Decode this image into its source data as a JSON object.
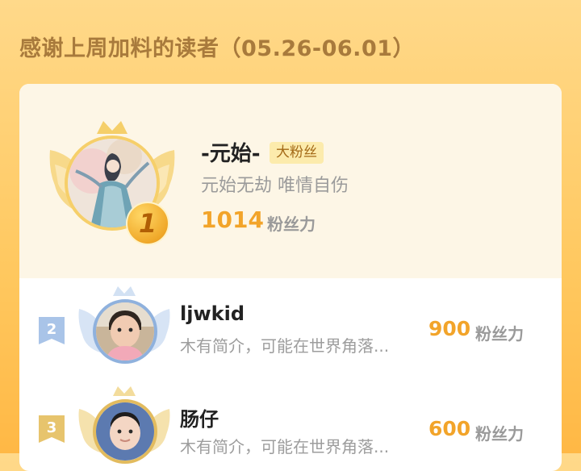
{
  "header": {
    "title": "感谢上周加料的读者（05.26-06.01）"
  },
  "top_reader": {
    "rank": "1",
    "name": "-元始-",
    "tag": "大粉丝",
    "bio": "元始无劫 唯情自伤",
    "score": "1014",
    "score_unit": "粉丝力"
  },
  "readers": [
    {
      "rank": "2",
      "name": "ljwkid",
      "bio": "木有简介，可能在世界角落...",
      "score": "900",
      "score_unit": "粉丝力"
    },
    {
      "rank": "3",
      "name": "肠仔",
      "bio": "木有简介，可能在世界角落...",
      "score": "600",
      "score_unit": "粉丝力"
    }
  ],
  "colors": {
    "accent": "#f2a42a",
    "title": "#a87a3c",
    "rank2": "#a9c4e8",
    "rank3": "#e7c46d"
  },
  "icons": [
    "crown-icon",
    "wings-icon",
    "rank-badge-icon"
  ]
}
